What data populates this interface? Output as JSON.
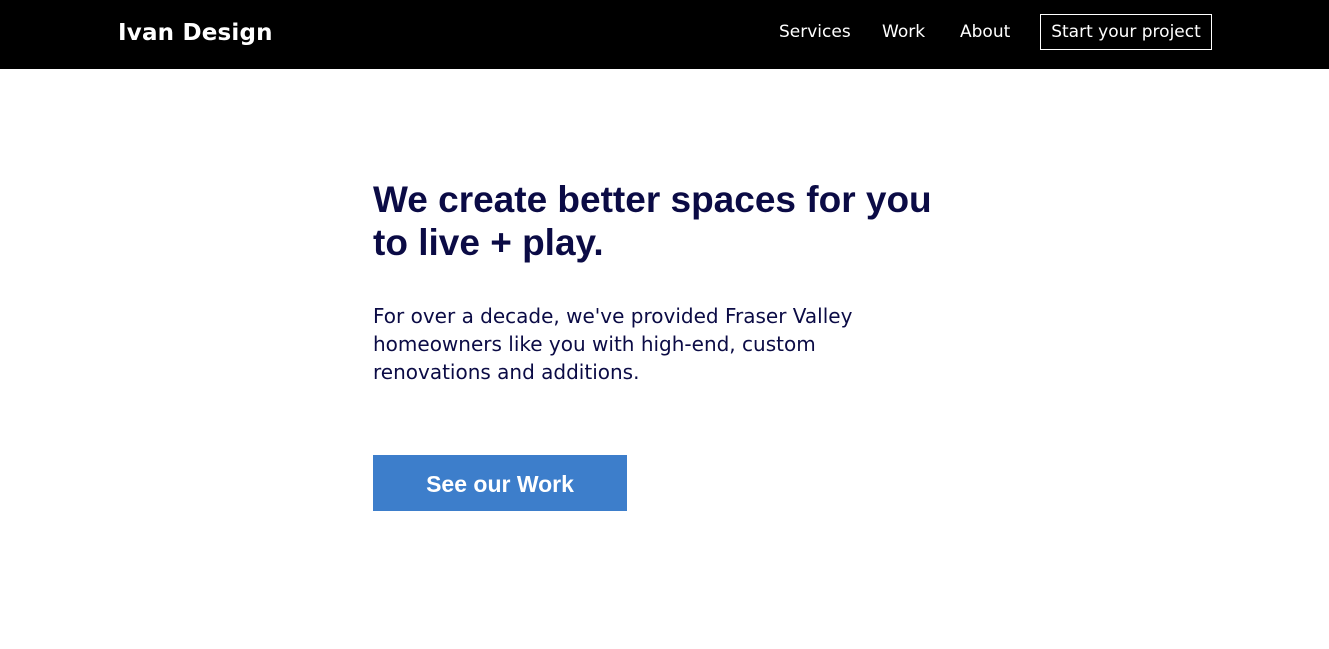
{
  "header": {
    "brand": "Ivan Design",
    "nav": [
      {
        "label": "Services"
      },
      {
        "label": "Work"
      },
      {
        "label": "About"
      }
    ],
    "cta_label": "Start your project"
  },
  "hero": {
    "title": "We create better spaces for you to live + play.",
    "body": "For over a decade, we've provided Fraser Valley homeowners like you with high-end, custom renovations and additions.",
    "button_label": "See our Work"
  },
  "colors": {
    "header_bg": "#000000",
    "header_text": "#ffffff",
    "heading_text": "#0b0b45",
    "button_bg": "#3d7ecb",
    "page_bg": "#ffffff"
  }
}
